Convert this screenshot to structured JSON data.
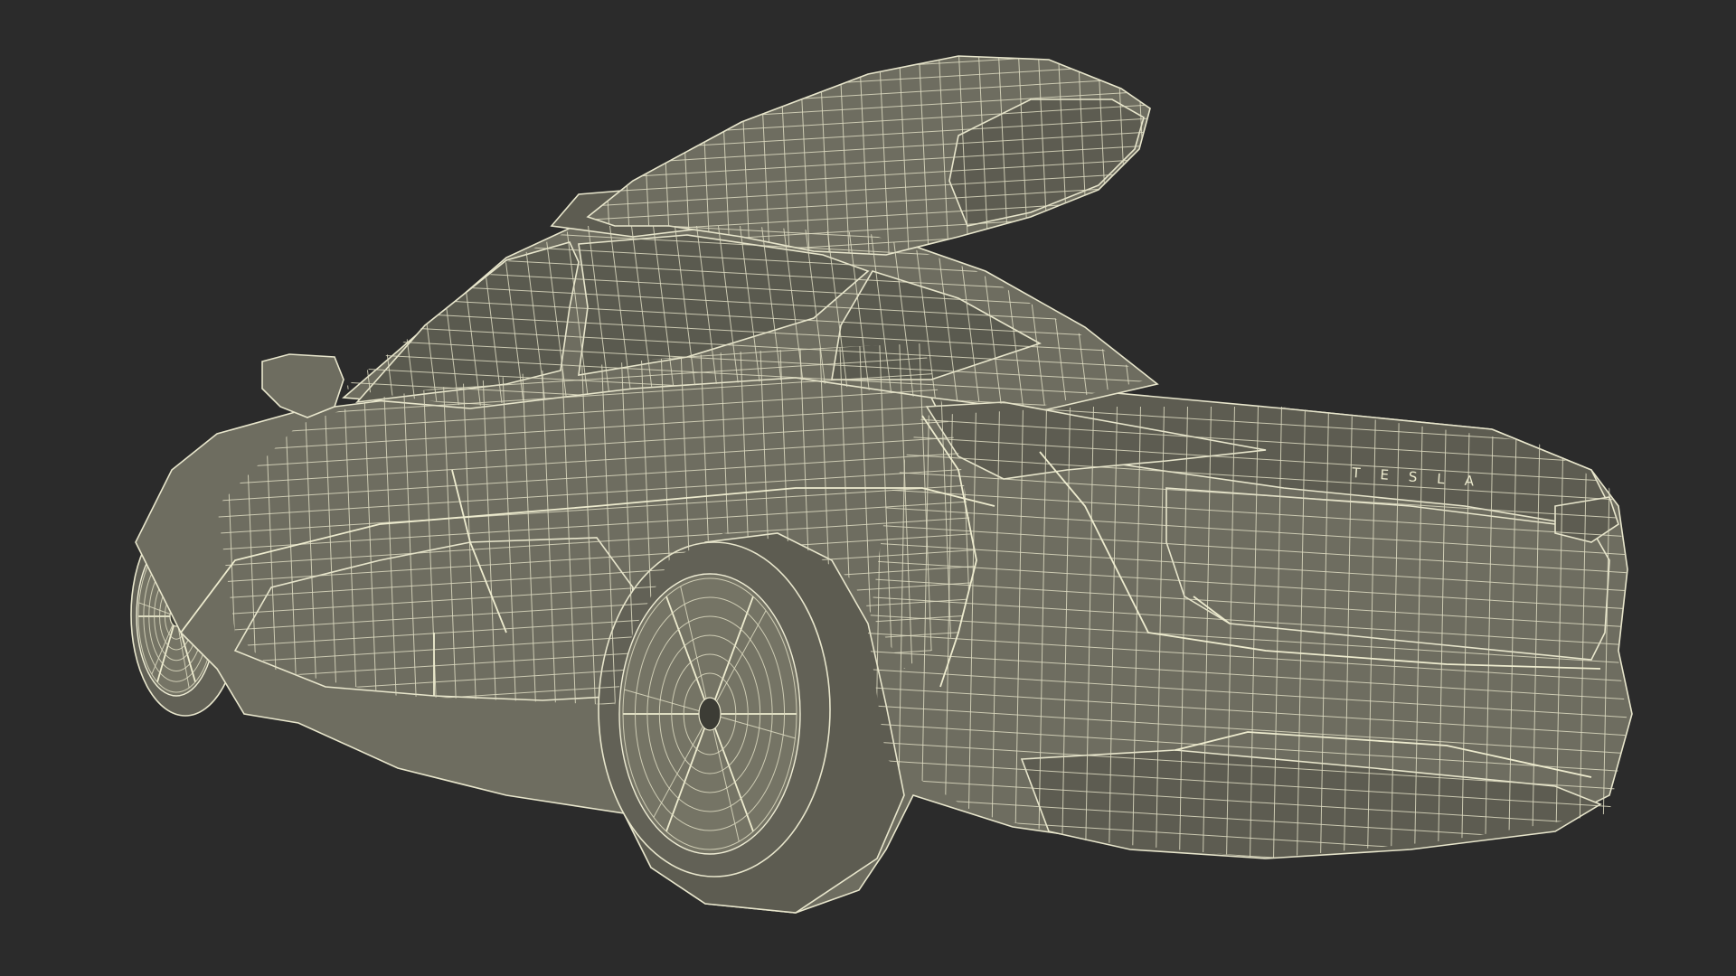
{
  "image": {
    "subject": "wireframe-car-with-roof-box",
    "background_color": "#2b2b2b",
    "shaded_surface_color": "#6e6d60",
    "wire_color": "#e8e6cc"
  },
  "rear_badge": {
    "text": "TESLA"
  }
}
